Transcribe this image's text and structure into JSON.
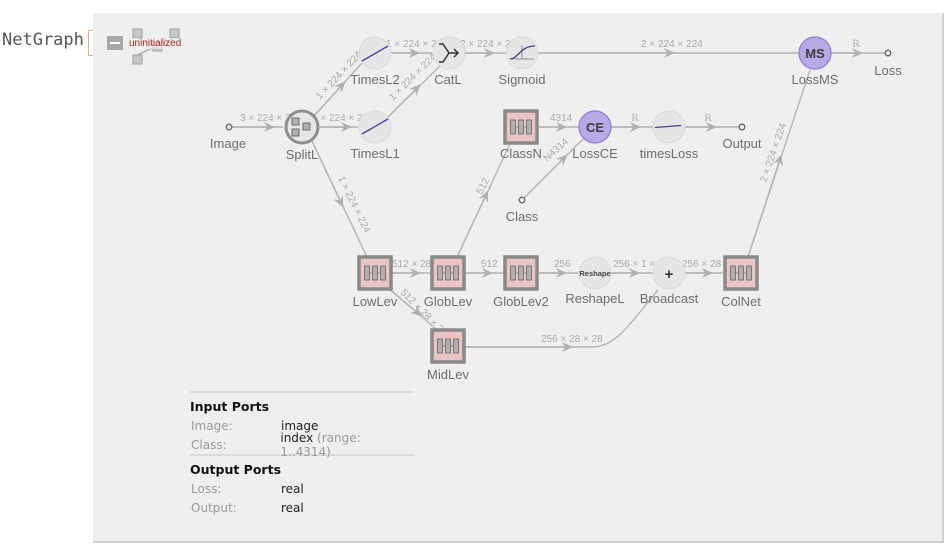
{
  "header": {
    "label": "NetGraph",
    "status": "uninitialized"
  },
  "nodes": {
    "image": "Image",
    "splitl": "SplitL",
    "timesl2": "TimesL2",
    "timesl1": "TimesL1",
    "catl": "CatL",
    "sigmoid": "Sigmoid",
    "lossms": "LossMS",
    "loss": "Loss",
    "classn": "ClassN",
    "lossce": "LossCE",
    "timesloss": "timesLoss",
    "output": "Output",
    "class": "Class",
    "lowlev": "LowLev",
    "globlev": "GlobLev",
    "globlev2": "GlobLev2",
    "reshapel": "ReshapeL",
    "broadcast": "Broadcast",
    "colnet": "ColNet",
    "midlev": "MidLev"
  },
  "node_glyphs": {
    "lossms": "MS",
    "lossce": "CE",
    "reshapel": "Reshape",
    "broadcast": "+"
  },
  "edges": {
    "image_splitl": "3 × 224 × 224",
    "splitl_timesl2": "1 × 224 × 224",
    "splitl_timesl1": "1 × 224 × 224",
    "splitl_lowlev": "1 × 224 × 224",
    "timesl2_catl": "1 × 224 × 224",
    "timesl1_catl": "1 × 224 × 224",
    "catl_sigmoid": "2 × 224 × 224",
    "sigmoid_lossms": "2 × 224 × 224",
    "lossms_loss": "ℝ",
    "classn_lossce": "4314",
    "class_lossce": "N4314",
    "lossce_timesloss": "ℝ",
    "timesloss_output": "ℝ",
    "globlev_classn": "512",
    "lowlev_globlev": "512 × 28 × 28",
    "lowlev_midlev": "512 × 28 × 28",
    "globlev_globlev2": "512",
    "globlev2_reshapel": "256",
    "reshapel_broadcast": "256 × 1 × 1",
    "broadcast_colnet": "256 × 28 × 28",
    "midlev_broadcast": "256 × 28 × 28",
    "colnet_lossms": "2 × 224 × 224"
  },
  "ports": {
    "input_title": "Input Ports",
    "inputs": [
      {
        "name": "Image:",
        "type": "image",
        "extra": ""
      },
      {
        "name": "Class:",
        "type": "index",
        "extra": "(range: 1..4314)"
      }
    ],
    "output_title": "Output Ports",
    "outputs": [
      {
        "name": "Loss:",
        "type": "real"
      },
      {
        "name": "Output:",
        "type": "real"
      }
    ]
  },
  "colors": {
    "panel_bg": "#efefef",
    "edge": "#b4b4b4",
    "layer_box_fill": "#ebc5c5",
    "layer_box_border": "#8a8a8a",
    "loss_node_fill": "#b9a8e6",
    "loss_node_border": "#8f7ad6",
    "circle_node_fill": "#e6e6e6",
    "curve": "#4a3a9a",
    "status": "#b22222"
  }
}
